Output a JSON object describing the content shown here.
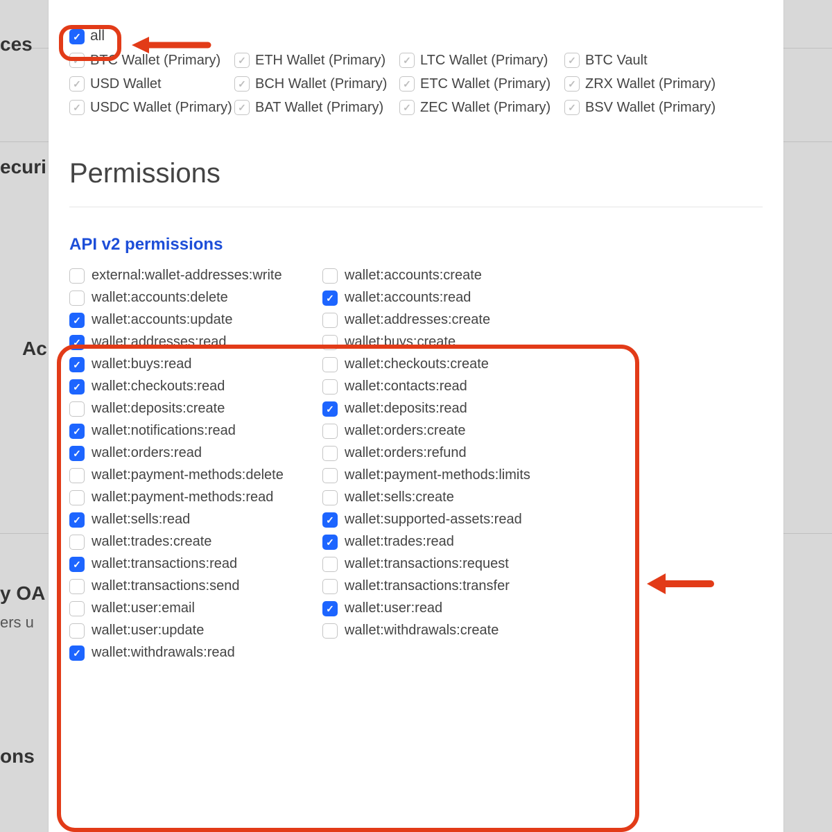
{
  "background": {
    "left_items": [
      "ces",
      "ecuri",
      "Ac",
      "y OA",
      "ers u",
      "ons"
    ]
  },
  "accounts": {
    "all_label": "all",
    "items": [
      {
        "label": "BTC Wallet (Primary)",
        "state": "grey"
      },
      {
        "label": "ETH Wallet (Primary)",
        "state": "grey"
      },
      {
        "label": "LTC Wallet (Primary)",
        "state": "grey"
      },
      {
        "label": "BTC Vault",
        "state": "grey"
      },
      {
        "label": "USD Wallet",
        "state": "grey"
      },
      {
        "label": "BCH Wallet (Primary)",
        "state": "grey"
      },
      {
        "label": "ETC Wallet (Primary)",
        "state": "grey"
      },
      {
        "label": "ZRX Wallet (Primary)",
        "state": "grey"
      },
      {
        "label": "USDC Wallet (Primary)",
        "state": "grey"
      },
      {
        "label": "BAT Wallet (Primary)",
        "state": "grey"
      },
      {
        "label": "ZEC Wallet (Primary)",
        "state": "grey"
      },
      {
        "label": "BSV Wallet (Primary)",
        "state": "grey"
      }
    ]
  },
  "headings": {
    "permissions": "Permissions",
    "api_v2": "API v2 permissions"
  },
  "permissions": [
    {
      "label": "external:wallet-addresses:write",
      "checked": false
    },
    {
      "label": "wallet:accounts:create",
      "checked": false
    },
    {
      "label": "wallet:accounts:delete",
      "checked": false
    },
    {
      "label": "wallet:accounts:read",
      "checked": true
    },
    {
      "label": "wallet:accounts:update",
      "checked": true
    },
    {
      "label": "wallet:addresses:create",
      "checked": false
    },
    {
      "label": "wallet:addresses:read",
      "checked": true
    },
    {
      "label": "wallet:buys:create",
      "checked": false
    },
    {
      "label": "wallet:buys:read",
      "checked": true
    },
    {
      "label": "wallet:checkouts:create",
      "checked": false
    },
    {
      "label": "wallet:checkouts:read",
      "checked": true
    },
    {
      "label": "wallet:contacts:read",
      "checked": false
    },
    {
      "label": "wallet:deposits:create",
      "checked": false
    },
    {
      "label": "wallet:deposits:read",
      "checked": true
    },
    {
      "label": "wallet:notifications:read",
      "checked": true
    },
    {
      "label": "wallet:orders:create",
      "checked": false
    },
    {
      "label": "wallet:orders:read",
      "checked": true
    },
    {
      "label": "wallet:orders:refund",
      "checked": false
    },
    {
      "label": "wallet:payment-methods:delete",
      "checked": false
    },
    {
      "label": "wallet:payment-methods:limits",
      "checked": false
    },
    {
      "label": "wallet:payment-methods:read",
      "checked": false
    },
    {
      "label": "wallet:sells:create",
      "checked": false
    },
    {
      "label": "wallet:sells:read",
      "checked": true
    },
    {
      "label": "wallet:supported-assets:read",
      "checked": true
    },
    {
      "label": "wallet:trades:create",
      "checked": false
    },
    {
      "label": "wallet:trades:read",
      "checked": true
    },
    {
      "label": "wallet:transactions:read",
      "checked": true
    },
    {
      "label": "wallet:transactions:request",
      "checked": false
    },
    {
      "label": "wallet:transactions:send",
      "checked": false
    },
    {
      "label": "wallet:transactions:transfer",
      "checked": false
    },
    {
      "label": "wallet:user:email",
      "checked": false
    },
    {
      "label": "wallet:user:read",
      "checked": true
    },
    {
      "label": "wallet:user:update",
      "checked": false
    },
    {
      "label": "wallet:withdrawals:create",
      "checked": false
    },
    {
      "label": "wallet:withdrawals:read",
      "checked": true
    }
  ]
}
